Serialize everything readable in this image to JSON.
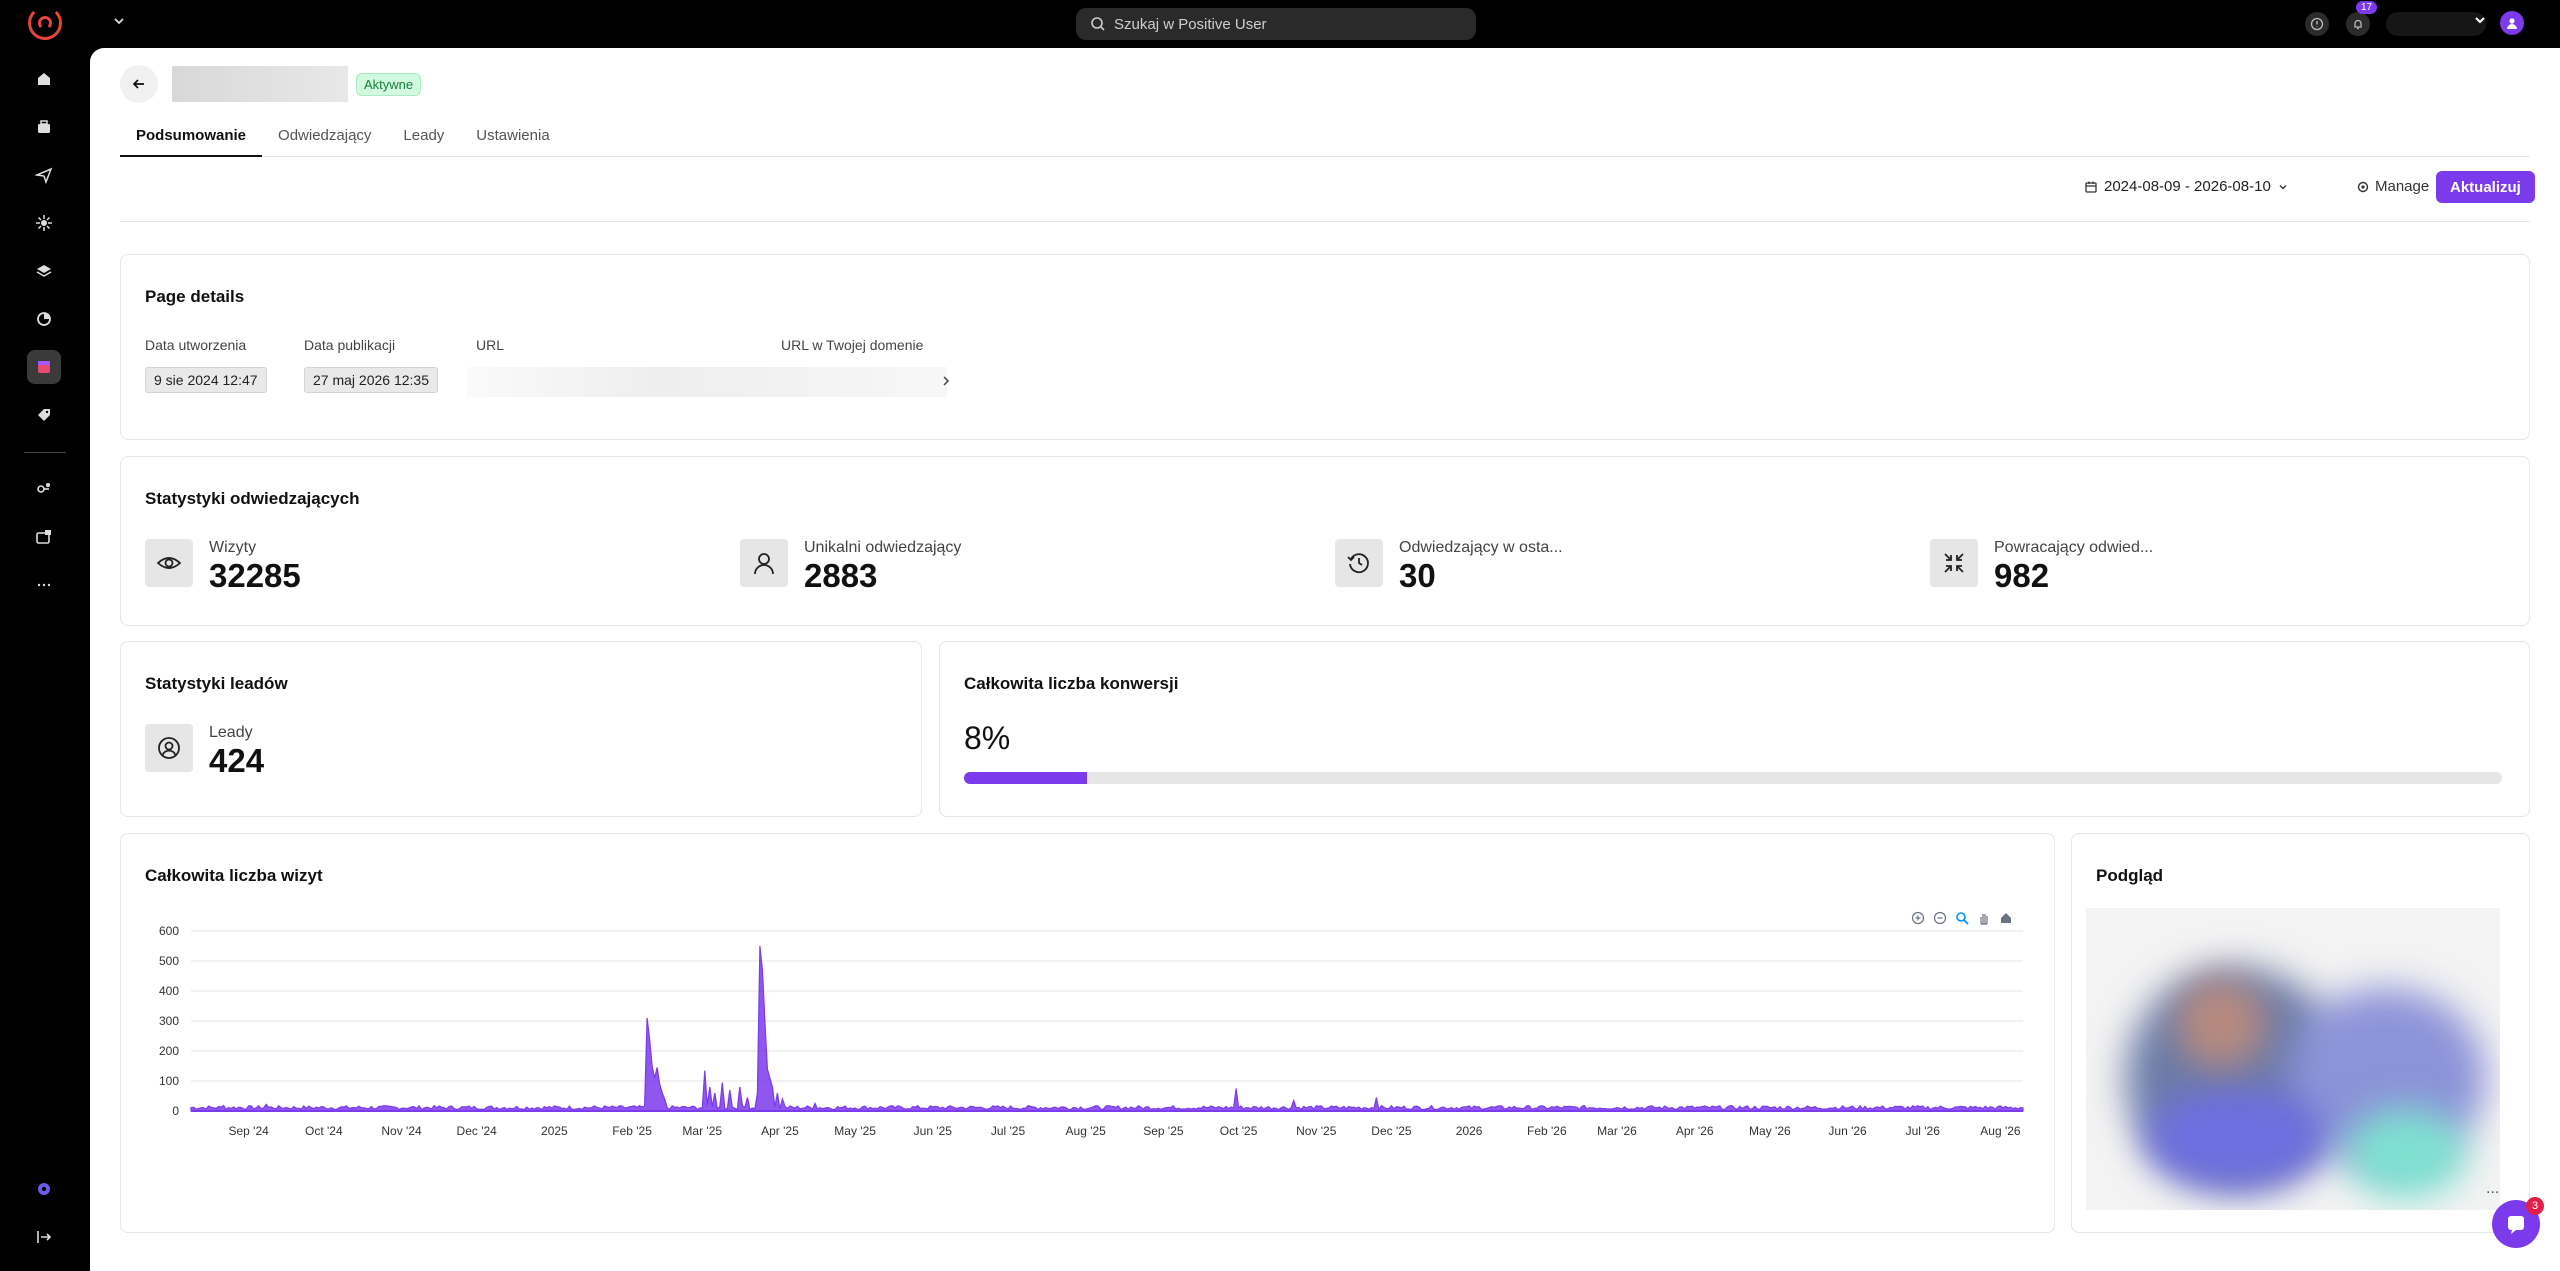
{
  "topbar": {
    "search_placeholder": "Szukaj w Positive User",
    "notifications_count": "17"
  },
  "sidebar": {
    "items": [
      "home-icon",
      "briefcase-icon",
      "send-icon",
      "integrations-icon",
      "layers-icon",
      "analytics-icon",
      "landing-pages-icon",
      "tag-icon",
      "automation-icon",
      "media-icon",
      "more-icon"
    ],
    "active": "landing-pages-icon"
  },
  "header": {
    "status": "Aktywne"
  },
  "tabs": [
    {
      "label": "Podsumowanie",
      "active": true
    },
    {
      "label": "Odwiedzający",
      "active": false
    },
    {
      "label": "Leady",
      "active": false
    },
    {
      "label": "Ustawienia",
      "active": false
    }
  ],
  "toolbar": {
    "date_range": "2024-08-09 - 2026-08-10",
    "manage_label": "Manage",
    "update_label": "Aktualizuj"
  },
  "page_details": {
    "title": "Page details",
    "created_label": "Data utworzenia",
    "created_value": "9 sie 2024 12:47",
    "published_label": "Data publikacji",
    "published_value": "27 maj 2026 12:35",
    "url_label": "URL",
    "domain_url_label": "URL w Twojej domenie"
  },
  "visitor_stats": {
    "title": "Statystyki odwiedzających",
    "items": [
      {
        "label": "Wizyty",
        "value": "32285"
      },
      {
        "label": "Unikalni odwiedzający",
        "value": "2883"
      },
      {
        "label": "Odwiedzający w osta...",
        "value": "30"
      },
      {
        "label": "Powracający odwied...",
        "value": "982"
      }
    ]
  },
  "lead_stats": {
    "title": "Statystyki leadów",
    "label": "Leady",
    "value": "424"
  },
  "conversions": {
    "title": "Całkowita liczba konwersji",
    "value": "8%",
    "fraction": 0.08
  },
  "visits_chart": {
    "title": "Całkowita liczba wizyt"
  },
  "preview": {
    "title": "Podgląd",
    "menu": "..."
  },
  "chat": {
    "badge": "3"
  },
  "colors": {
    "accent": "#7c3aed",
    "status_bg": "#d1fadf",
    "status_text": "#17803d"
  },
  "chart_data": {
    "type": "area",
    "title": "Całkowita liczba wizyt",
    "xlabel": "",
    "ylabel": "",
    "ylim": [
      0,
      600
    ],
    "yticks": [
      0,
      100,
      200,
      300,
      400,
      500,
      600
    ],
    "x_ticks": [
      "Sep '24",
      "Oct '24",
      "Nov '24",
      "Dec '24",
      "2025",
      "Feb '25",
      "Mar '25",
      "Apr '25",
      "May '25",
      "Jun '25",
      "Jul '25",
      "Aug '25",
      "Sep '25",
      "Oct '25",
      "Nov '25",
      "Dec '25",
      "2026",
      "Feb '26",
      "Mar '26",
      "Apr '26",
      "May '26",
      "Jun '26",
      "Jul '26",
      "Aug '26"
    ],
    "x_range": [
      "2024-08-09",
      "2026-08-10"
    ],
    "grid": true,
    "series": [
      {
        "color": "#7c3aed",
        "baseline": 12,
        "peaks": [
          {
            "date": "2024-08-22",
            "value": 18
          },
          {
            "date": "2024-09-08",
            "value": 22
          },
          {
            "date": "2025-02-07",
            "value": 310
          },
          {
            "date": "2025-02-08",
            "value": 240
          },
          {
            "date": "2025-02-09",
            "value": 150
          },
          {
            "date": "2025-02-10",
            "value": 110
          },
          {
            "date": "2025-02-11",
            "value": 145
          },
          {
            "date": "2025-02-12",
            "value": 90
          },
          {
            "date": "2025-02-13",
            "value": 60
          },
          {
            "date": "2025-02-14",
            "value": 40
          },
          {
            "date": "2025-03-02",
            "value": 135
          },
          {
            "date": "2025-03-04",
            "value": 80
          },
          {
            "date": "2025-03-06",
            "value": 60
          },
          {
            "date": "2025-03-09",
            "value": 95
          },
          {
            "date": "2025-03-12",
            "value": 70
          },
          {
            "date": "2025-03-16",
            "value": 80
          },
          {
            "date": "2025-03-19",
            "value": 45
          },
          {
            "date": "2025-03-23",
            "value": 60
          },
          {
            "date": "2025-03-24",
            "value": 550
          },
          {
            "date": "2025-03-25",
            "value": 470
          },
          {
            "date": "2025-03-26",
            "value": 300
          },
          {
            "date": "2025-03-27",
            "value": 140
          },
          {
            "date": "2025-03-28",
            "value": 110
          },
          {
            "date": "2025-03-29",
            "value": 80
          },
          {
            "date": "2025-03-31",
            "value": 60
          },
          {
            "date": "2025-04-02",
            "value": 40
          },
          {
            "date": "2025-04-15",
            "value": 25
          },
          {
            "date": "2025-09-30",
            "value": 75
          },
          {
            "date": "2025-10-23",
            "value": 35
          },
          {
            "date": "2025-11-25",
            "value": 45
          }
        ]
      }
    ]
  }
}
